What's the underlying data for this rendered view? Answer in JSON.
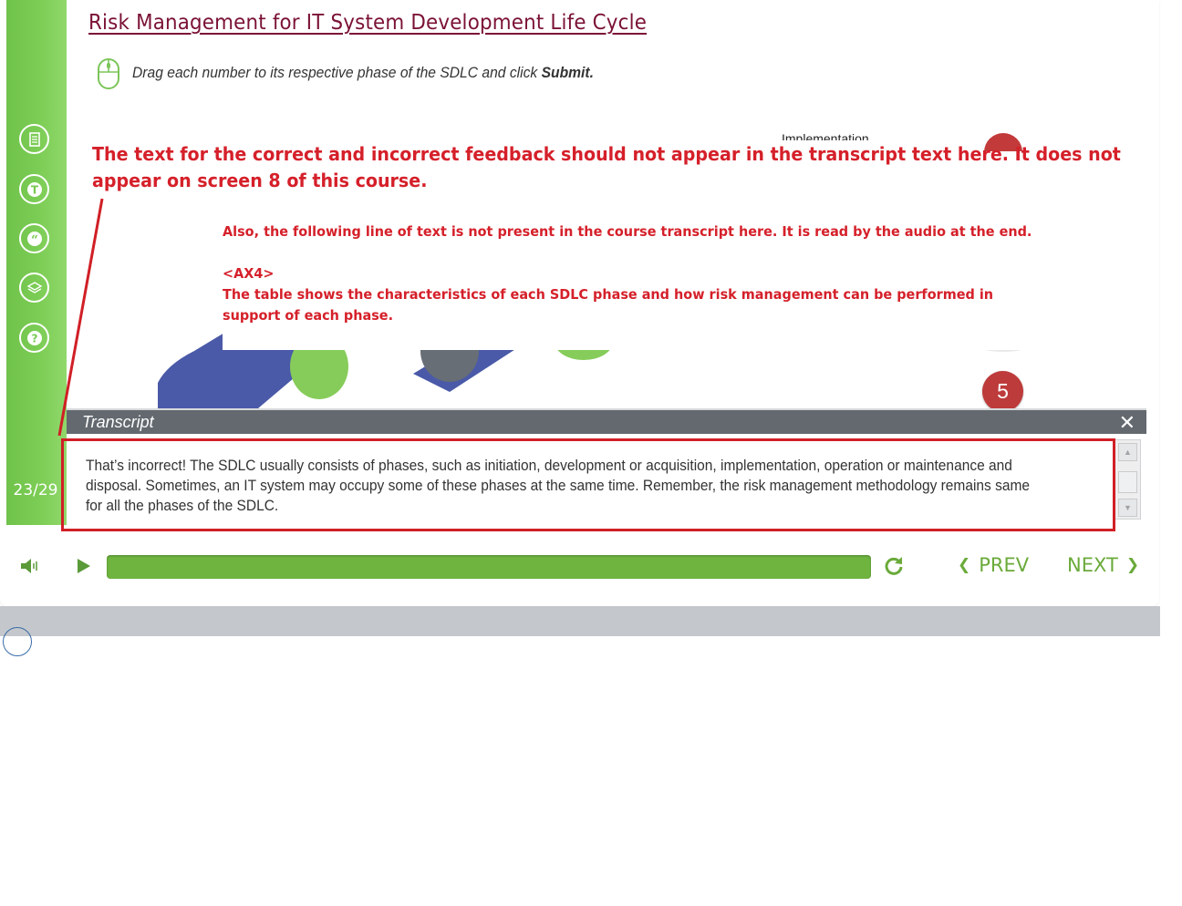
{
  "course": {
    "title": "Risk Management for IT System Development Life Cycle",
    "instruction_text": "Drag each number to its respective phase of the SDLC and click ",
    "instruction_submit": "Submit."
  },
  "stage": {
    "partial_label": "Implementation",
    "badge_number": "5"
  },
  "sidebar": {
    "page_counter": "23/29",
    "buttons": [
      "notes-icon",
      "t-icon",
      "quote-icon",
      "layers-icon",
      "help-icon"
    ]
  },
  "annotation": {
    "main": "The text for the correct and incorrect feedback should not appear in the transcript text here. It does not appear on screen 8 of this course.",
    "main_line1": "The text for the correct and incorrect feedback should not appear in the transcript text here. It does not",
    "main_line2": "appear on screen 8 of this course.",
    "sub_line1": "Also, the following line of text is not present in the course transcript here. It is read by the audio at the end.",
    "sub_tag": "<AX4>",
    "sub_line2": "The table shows the characteristics of each SDLC phase and how risk management can be performed in support of each phase.",
    "color": "#d5202a"
  },
  "transcript": {
    "title": "Transcript",
    "close_glyph": "✕",
    "body": "That’s incorrect! The SDLC usually consists of phases, such as initiation, development or acquisition, implementation, operation or maintenance and disposal. Sometimes, an IT system may occupy some of these phases at the same time. Remember, the risk management methodology remains same for all the phases of the SDLC."
  },
  "controls": {
    "progress_fraction": 1.0,
    "prev_label": "PREV",
    "next_label": "NEXT",
    "accent": "#6eb43f"
  }
}
